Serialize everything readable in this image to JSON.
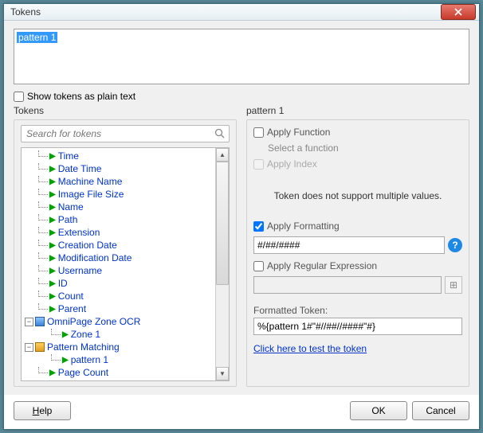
{
  "window": {
    "title": "Tokens"
  },
  "textarea": {
    "chip": "pattern 1"
  },
  "showPlain": {
    "label": "Show tokens as plain text"
  },
  "left": {
    "group": "Tokens",
    "searchPlaceholder": "Search for tokens",
    "items": {
      "time": "Time",
      "datetime": "Date Time",
      "machine": "Machine Name",
      "filesize": "Image File Size",
      "name": "Name",
      "path": "Path",
      "extension": "Extension",
      "creation": "Creation Date",
      "modification": "Modification Date",
      "username": "Username",
      "id": "ID",
      "count": "Count",
      "parent": "Parent",
      "omnipage": "OmniPage Zone OCR",
      "zone1": "Zone 1",
      "patternmatch": "Pattern Matching",
      "pattern1": "pattern 1",
      "pagecount": "Page Count"
    }
  },
  "right": {
    "group": "pattern 1",
    "applyFunction": "Apply Function",
    "selectFunction": "Select a function",
    "applyIndex": "Apply Index",
    "noMulti": "Token does not support multiple values.",
    "applyFormatting": "Apply Formatting",
    "formatValue": "#/##/####",
    "applyRegex": "Apply Regular Expression",
    "regexValue": "",
    "formattedLabel": "Formatted Token:",
    "formattedValue": "%{pattern 1#\"#//##//####\"#}",
    "testLink": "Click here to test the token"
  },
  "footer": {
    "help": "Help",
    "ok": "OK",
    "cancel": "Cancel"
  }
}
